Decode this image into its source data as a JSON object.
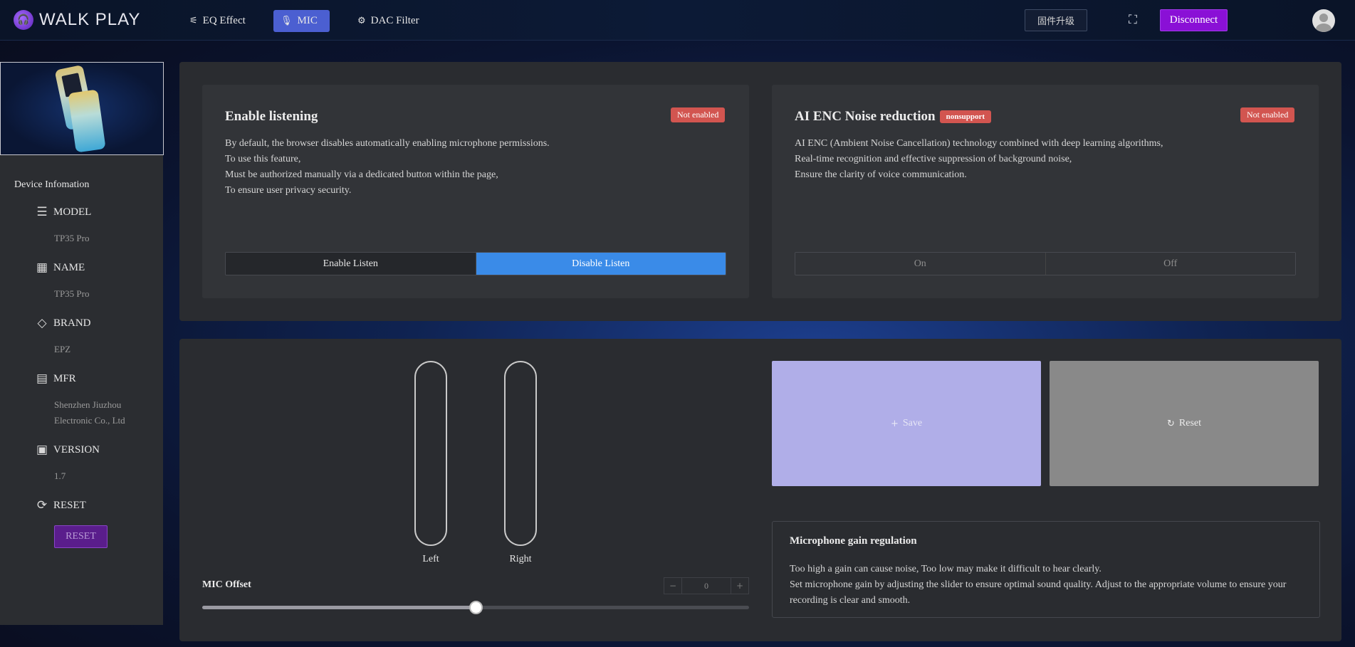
{
  "app": {
    "title": "WALK PLAY",
    "logo_glyph": "🎧"
  },
  "nav": [
    {
      "label": "EQ Effect",
      "icon": "sliders-icon",
      "glyph": "⚟"
    },
    {
      "label": "MIC",
      "icon": "microphone-icon",
      "glyph": "🎙",
      "active": true
    },
    {
      "label": "DAC Filter",
      "icon": "gear-icon",
      "glyph": "⚙"
    }
  ],
  "header": {
    "firmware_label": "固件升级",
    "scan_glyph": "⛶",
    "disconnect_label": "Disconnect"
  },
  "sidebar": {
    "title": "Device Infomation",
    "items": [
      {
        "label": "MODEL",
        "value": "TP35 Pro",
        "icon": "server-icon",
        "glyph": "☰"
      },
      {
        "label": "NAME",
        "value": "TP35 Pro",
        "icon": "building-icon",
        "glyph": "▦"
      },
      {
        "label": "BRAND",
        "value": "EPZ",
        "icon": "tag-icon",
        "glyph": "◇"
      },
      {
        "label": "MFR",
        "value": "Shenzhen Jiuzhou Electronic Co., Ltd",
        "icon": "document-icon",
        "glyph": "▤"
      },
      {
        "label": "VERSION",
        "value": "1.7",
        "icon": "chip-icon",
        "glyph": "▣"
      },
      {
        "label": "RESET",
        "icon": "refresh-icon",
        "glyph": "⟳"
      }
    ],
    "reset_button": "RESET"
  },
  "listening": {
    "title": "Enable listening",
    "status": "Not enabled",
    "lines": [
      "By default, the browser disables automatically enabling microphone permissions.",
      "To use this feature,",
      "Must be authorized manually via a dedicated button within the page,",
      "To ensure user privacy security."
    ],
    "enable_label": "Enable Listen",
    "disable_label": "Disable Listen"
  },
  "enc": {
    "title": "AI ENC Noise reduction",
    "tag": "nonsupport",
    "status": "Not enabled",
    "lines": [
      "AI ENC (Ambient Noise Cancellation) technology combined with deep learning algorithms,",
      "Real-time recognition and effective suppression of background noise,",
      "Ensure the clarity of voice communication."
    ],
    "on_label": "On",
    "off_label": "Off"
  },
  "meters": {
    "left_label": "Left",
    "right_label": "Right"
  },
  "offset": {
    "title": "MIC Offset",
    "value": "0",
    "minus": "−",
    "plus": "+",
    "slider_fraction": 0.5
  },
  "actions": {
    "save_label": "Save",
    "reset_label": "Reset",
    "save_glyph": "+",
    "reset_glyph": "↻"
  },
  "gain": {
    "title": "Microphone gain regulation",
    "lines": [
      "Too high a gain can cause noise, Too low may make it difficult to hear clearly.",
      "Set microphone gain by adjusting the slider to ensure optimal sound quality. Adjust to the appropriate volume to ensure your recording is clear and smooth."
    ]
  },
  "colors": {
    "accent": "#4b5fd1",
    "disconnect": "#8a10d6",
    "status_red": "#d25550",
    "listen_blue": "#3a8be8",
    "save_purple": "#b0aee8"
  }
}
